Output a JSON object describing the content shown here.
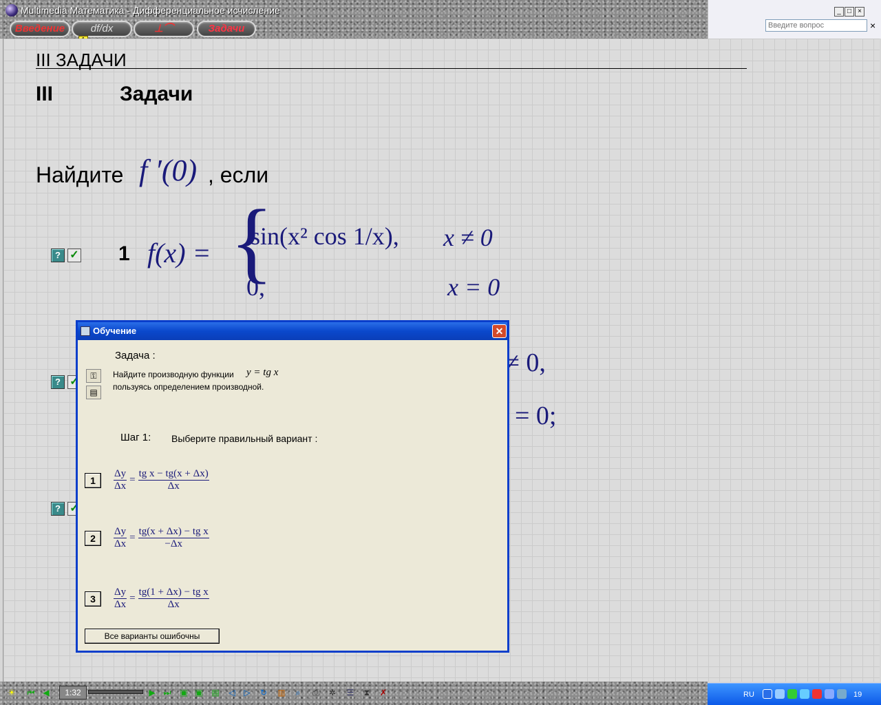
{
  "window": {
    "title": "Multimedia Математика - Дифференциальное исчисление",
    "help_placeholder": "Введите вопрос",
    "close_glyph": "×"
  },
  "nav": {
    "tabs": [
      {
        "label": "Введение"
      },
      {
        "label": "df/dx"
      },
      {
        "label": "⊥⌒"
      },
      {
        "label": "Задачи"
      }
    ],
    "badge": "1"
  },
  "page": {
    "heading": "III  ЗАДАЧИ",
    "section_number": "III",
    "section_title": "Задачи",
    "prompt_find": "Найдите",
    "prompt_fprime": "f ′(0)",
    "prompt_if": ", если",
    "task1_number": "1",
    "task1_lhs": "f(x) =",
    "task1_case1": "sin(x² cos 1/x),",
    "task1_case1_cond": "x ≠ 0",
    "task1_case2": "0,",
    "task1_case2_cond": "x = 0",
    "hidden_frag1": "≠ 0,",
    "hidden_frag2": "= 0;",
    "help_glyph": "?",
    "check_glyph": "✓"
  },
  "dialog": {
    "title": "Обучение",
    "task_label": "Задача :",
    "task_text_1": "Найдите производную функции",
    "task_formula": "y = tg x",
    "task_text_2": "пользуясь определением производной.",
    "step_label": "Шаг 1:",
    "step_instruction": "Выберите правильный вариант :",
    "options": [
      {
        "num": "1",
        "lhs_n": "Δy",
        "lhs_d": "Δx",
        "rhs_n": "tg x − tg(x + Δx)",
        "rhs_d": "Δx"
      },
      {
        "num": "2",
        "lhs_n": "Δy",
        "lhs_d": "Δx",
        "rhs_n": "tg(x + Δx) − tg x",
        "rhs_d": "−Δx"
      },
      {
        "num": "3",
        "lhs_n": "Δy",
        "lhs_d": "Δx",
        "rhs_n": "tg(1 + Δx) − tg x",
        "rhs_d": "Δx"
      }
    ],
    "all_wrong_label": "Все варианты ошибочны",
    "close_glyph": "✕"
  },
  "player": {
    "time": "1:32"
  },
  "taskbar": {
    "language": "RU",
    "clock": "19"
  },
  "colors": {
    "accent_title": "#0a3ecb",
    "math": "#1a1a7a",
    "tab_active": "#ff3344"
  }
}
